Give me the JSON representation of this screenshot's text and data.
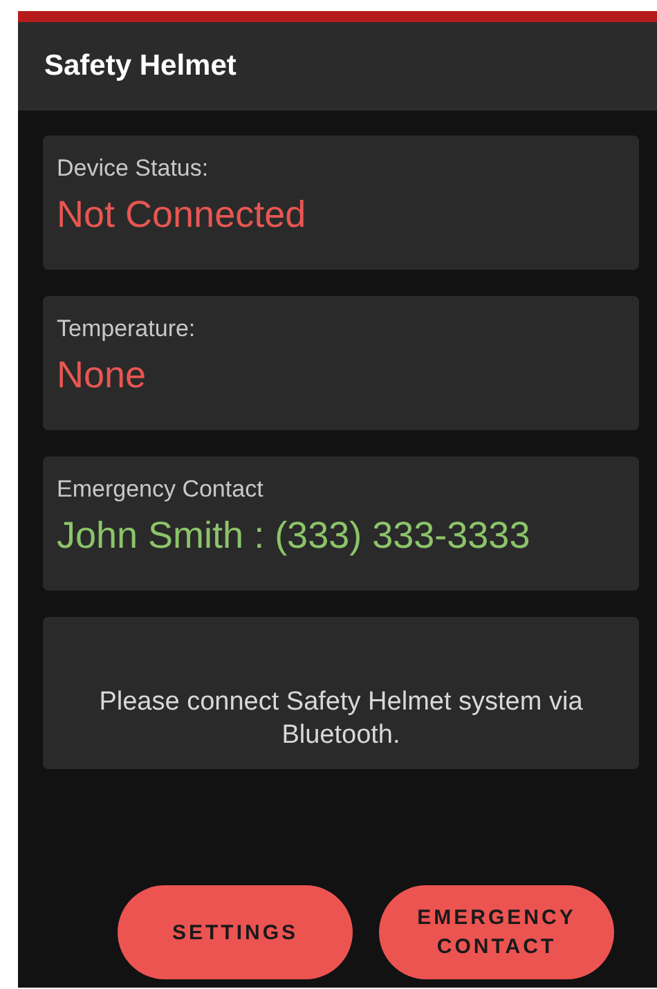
{
  "app_bar": {
    "title": "Safety Helmet"
  },
  "cards": [
    {
      "kind": "field",
      "label": "Device Status:",
      "value": "Not Connected",
      "color": "#e85652"
    },
    {
      "kind": "field",
      "label": "Temperature:",
      "value": "None",
      "color": "#e85652"
    },
    {
      "kind": "field",
      "label": "Emergency Contact",
      "value": "John Smith : (333) 333-3333",
      "color": "#8cc46a"
    },
    {
      "kind": "message",
      "text": "Please connect Safety Helmet system via Bluetooth."
    }
  ],
  "buttons": [
    {
      "label": "SETTINGS"
    },
    {
      "label": "EMERGENCY CONTACT"
    }
  ]
}
